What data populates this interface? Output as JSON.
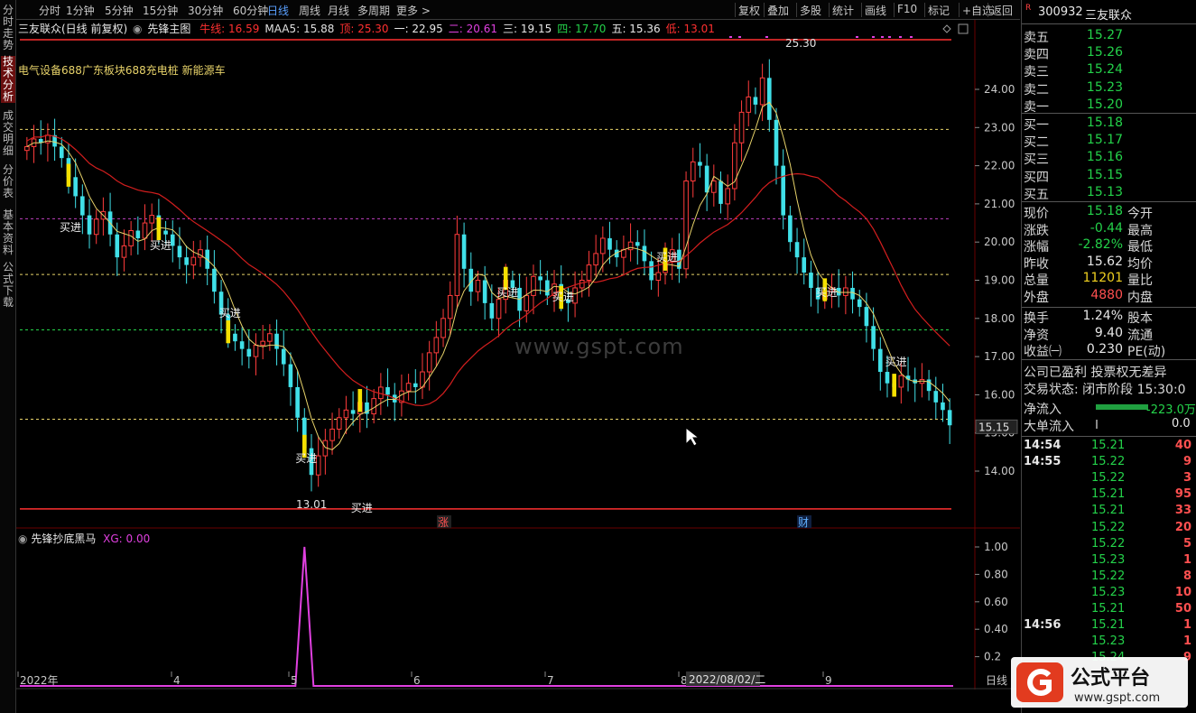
{
  "toolbar": {
    "periods": [
      "分时",
      "1分钟",
      "5分钟",
      "15分钟",
      "30分钟",
      "60分钟",
      "日线",
      "周线",
      "月线",
      "多周期",
      "更多 >"
    ],
    "active": "日线",
    "right": [
      "复权",
      "叠加",
      "多股",
      "统计",
      "画线",
      "F10",
      "标记",
      "+自选",
      "返回"
    ]
  },
  "left_tabs": [
    "分时走势",
    "技术分析",
    "成交明细",
    "分价表",
    "基本资料",
    "公式下载"
  ],
  "left_active": "技术分析",
  "info": {
    "title": "三友联众(日线 前复权)",
    "indicator": "先锋主图",
    "items": [
      {
        "t": "牛线: 16.59",
        "c": "#ff3030"
      },
      {
        "t": "MAA5: 15.88",
        "c": "#e0e0e0"
      },
      {
        "t": "顶: 25.30",
        "c": "#ff3030"
      },
      {
        "t": "一: 22.95",
        "c": "#e8e8e8"
      },
      {
        "t": "二: 20.61",
        "c": "#e040e0"
      },
      {
        "t": "三: 19.15",
        "c": "#e8e8e8"
      },
      {
        "t": "四: 17.70",
        "c": "#24d24a"
      },
      {
        "t": "五: 15.36",
        "c": "#e8e8e8"
      },
      {
        "t": "低: 13.01",
        "c": "#ff3030"
      }
    ]
  },
  "sector": "电气设备688广东板块688充电桩 新能源车",
  "watermark": "www.gspt.com",
  "price_axis": [
    "24.00",
    "23.00",
    "22.00",
    "21.00",
    "20.00",
    "19.00",
    "18.00",
    "17.00",
    "16.00",
    "15.00",
    "14.00"
  ],
  "current_price_tag": "15.15",
  "peak_label": "25.30",
  "low_label": "13.01",
  "buy_label": "买进",
  "markers": {
    "zhang": "涨",
    "cai": "财"
  },
  "sub": {
    "name": "先锋抄底黑马",
    "xg": "XG: 0.00",
    "axis": [
      "1.00",
      "0.80",
      "0.60",
      "0.40",
      "0.2"
    ]
  },
  "date_axis": {
    "labels": [
      "2022年",
      "4",
      "5",
      "6",
      "7",
      "8",
      "9"
    ],
    "cursor": "2022/08/02/二",
    "period": "日线"
  },
  "quote": {
    "code": "300932",
    "name": "三友联众",
    "sell": [
      {
        "l": "卖五",
        "v": "15.27"
      },
      {
        "l": "卖四",
        "v": "15.26"
      },
      {
        "l": "卖三",
        "v": "15.24"
      },
      {
        "l": "卖二",
        "v": "15.23"
      },
      {
        "l": "卖一",
        "v": "15.20"
      }
    ],
    "buy": [
      {
        "l": "买一",
        "v": "15.18"
      },
      {
        "l": "买二",
        "v": "15.17"
      },
      {
        "l": "买三",
        "v": "15.16"
      },
      {
        "l": "买四",
        "v": "15.15"
      },
      {
        "l": "买五",
        "v": "15.13"
      }
    ],
    "stats": [
      {
        "l": "现价",
        "v": "15.18",
        "c": "g",
        "r": "今开"
      },
      {
        "l": "涨跌",
        "v": "-0.44",
        "c": "g",
        "r": "最高"
      },
      {
        "l": "涨幅",
        "v": "-2.82%",
        "c": "g",
        "r": "最低"
      },
      {
        "l": "昨收",
        "v": "15.62",
        "c": "w",
        "r": "均价"
      },
      {
        "l": "总量",
        "v": "11201",
        "c": "y",
        "r": "量比"
      },
      {
        "l": "外盘",
        "v": "4880",
        "c": "",
        "r": "内盘"
      }
    ],
    "stats2": [
      {
        "l": "换手",
        "v": "1.24%",
        "c": "w",
        "r": "股本"
      },
      {
        "l": "净资",
        "v": "9.40",
        "c": "w",
        "r": "流通"
      },
      {
        "l": "收益㈠",
        "v": "0.230",
        "c": "w",
        "r": "PE(动)"
      }
    ],
    "notice": "公司已盈利 投票权无差异",
    "trade_status": "交易状态: 闭市阶段 15:30:0",
    "netflow_l": "净流入",
    "netflow_v": "-223.0万",
    "bigflow_l": "大单流入",
    "bigflow_v": "0.0",
    "ticks": [
      {
        "t": "14:54",
        "p": "15.21",
        "v": "40"
      },
      {
        "t": "14:55",
        "p": "15.22",
        "v": "9"
      },
      {
        "t": "",
        "p": "15.22",
        "v": "3"
      },
      {
        "t": "",
        "p": "15.21",
        "v": "95"
      },
      {
        "t": "",
        "p": "15.21",
        "v": "33"
      },
      {
        "t": "",
        "p": "15.22",
        "v": "20"
      },
      {
        "t": "",
        "p": "15.22",
        "v": "5"
      },
      {
        "t": "",
        "p": "15.23",
        "v": "1"
      },
      {
        "t": "",
        "p": "15.22",
        "v": "8"
      },
      {
        "t": "",
        "p": "15.23",
        "v": "10"
      },
      {
        "t": "",
        "p": "15.21",
        "v": "50"
      },
      {
        "t": "14:56",
        "p": "15.21",
        "v": "1"
      },
      {
        "t": "",
        "p": "15.23",
        "v": "1"
      },
      {
        "t": "",
        "p": "15.24",
        "v": "9"
      }
    ]
  },
  "logo": {
    "text": "公式平台",
    "url": "www.gspt.com"
  },
  "colors": {
    "up": "#ff3c3c",
    "down": "#40e0e8",
    "ma_red": "#d21e1e",
    "ma_yellow": "#e8d36a",
    "buy": "#f5e000"
  },
  "chart_data": {
    "type": "candlestick",
    "title": "三友联众(日线 前复权)",
    "ylim": [
      13.0,
      25.3
    ],
    "levels": [
      {
        "name": "顶",
        "value": 25.3,
        "color": "#ff3030"
      },
      {
        "name": "一",
        "value": 22.95,
        "color": "#e8d36a"
      },
      {
        "name": "二",
        "value": 20.61,
        "color": "#c040c0"
      },
      {
        "name": "三",
        "value": 19.15,
        "color": "#e8d36a"
      },
      {
        "name": "四",
        "value": 17.7,
        "color": "#24d24a"
      },
      {
        "name": "五",
        "value": 15.36,
        "color": "#e8d36a"
      },
      {
        "name": "低",
        "value": 13.01,
        "color": "#ff3030"
      }
    ],
    "closes": [
      22.5,
      22.7,
      22.6,
      22.8,
      22.5,
      22.2,
      21.7,
      21.2,
      20.7,
      20.2,
      20.6,
      20.8,
      20.2,
      19.6,
      19.9,
      20.3,
      20.1,
      20.5,
      20.7,
      20.3,
      20.2,
      19.9,
      19.6,
      19.4,
      19.6,
      19.8,
      19.3,
      18.7,
      18.1,
      17.6,
      17.4,
      17.2,
      17.0,
      17.3,
      17.4,
      17.6,
      17.2,
      16.8,
      16.2,
      15.4,
      14.6,
      13.9,
      14.4,
      14.8,
      15.1,
      15.4,
      15.6,
      15.5,
      15.8,
      15.5,
      15.9,
      16.2,
      16.0,
      15.8,
      16.1,
      16.3,
      16.2,
      16.6,
      17.1,
      17.5,
      18.0,
      18.6,
      20.2,
      19.3,
      18.7,
      19.0,
      18.4,
      18.0,
      18.5,
      19.0,
      18.8,
      18.2,
      18.6,
      19.1,
      19.0,
      18.6,
      18.9,
      18.5,
      18.4,
      18.8,
      19.0,
      19.4,
      19.7,
      20.1,
      19.8,
      19.6,
      19.8,
      20.0,
      19.9,
      19.5,
      19.0,
      19.2,
      19.5,
      19.8,
      19.3,
      21.6,
      22.1,
      22.0,
      21.3,
      21.6,
      21.0,
      21.4,
      22.6,
      23.4,
      23.8,
      23.6,
      24.3,
      23.2,
      22.0,
      20.7,
      20.0,
      19.6,
      19.2,
      18.8,
      18.5,
      18.7,
      18.8,
      18.6,
      18.8,
      18.5,
      18.3,
      17.8,
      17.2,
      16.6,
      16.3,
      16.2,
      16.5,
      16.4,
      16.3,
      16.4,
      16.1,
      15.8,
      15.6,
      15.2
    ],
    "volume_indicator": {
      "name": "XG",
      "signal_index": 40,
      "value": 1.0
    }
  }
}
